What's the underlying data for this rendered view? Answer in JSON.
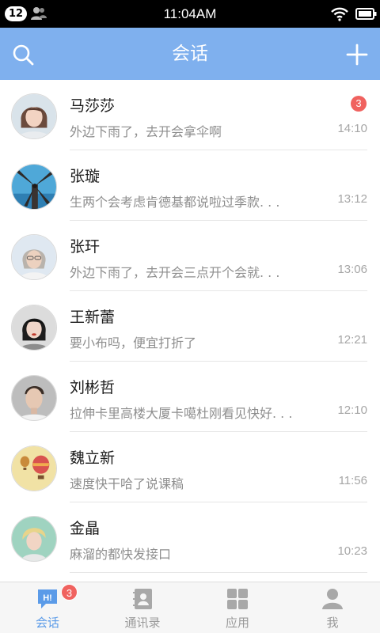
{
  "status_bar": {
    "notification_count": "12",
    "time": "11:04AM",
    "icons": [
      "contacts-sync-icon",
      "wifi-icon",
      "battery-icon"
    ]
  },
  "header": {
    "title": "会话",
    "left_icon": "search-icon",
    "right_icon": "plus-icon"
  },
  "conversations": [
    {
      "name": "马莎莎",
      "preview": "外边下雨了，去开会拿伞啊",
      "time": "14:10",
      "unread": "3"
    },
    {
      "name": "张璇",
      "preview": "生两个会考虑肯德基都说啦过季款. . .",
      "time": "13:12"
    },
    {
      "name": "张玕",
      "preview": "外边下雨了，去开会三点开个会就. . .",
      "time": "13:06"
    },
    {
      "name": "王新蕾",
      "preview": "要小布吗，便宜打折了",
      "time": "12:21"
    },
    {
      "name": "刘彬哲",
      "preview": "拉伸卡里高楼大厦卡噶杜刚看见快好. . .",
      "time": "12:10"
    },
    {
      "name": "魏立新",
      "preview": "速度快干哈了说课稿",
      "time": "11:56"
    },
    {
      "name": "金晶",
      "preview": "麻溜的都快发接口",
      "time": "10:23"
    }
  ],
  "tabs": [
    {
      "label": "会话",
      "icon": "chat-hi-icon",
      "badge": "3",
      "active": true
    },
    {
      "label": "通讯录",
      "icon": "address-book-icon"
    },
    {
      "label": "应用",
      "icon": "apps-grid-icon"
    },
    {
      "label": "我",
      "icon": "person-icon"
    }
  ],
  "colors": {
    "header_bg": "#7fb0ee",
    "badge": "#f0625f",
    "active_tab": "#5b9be8"
  }
}
